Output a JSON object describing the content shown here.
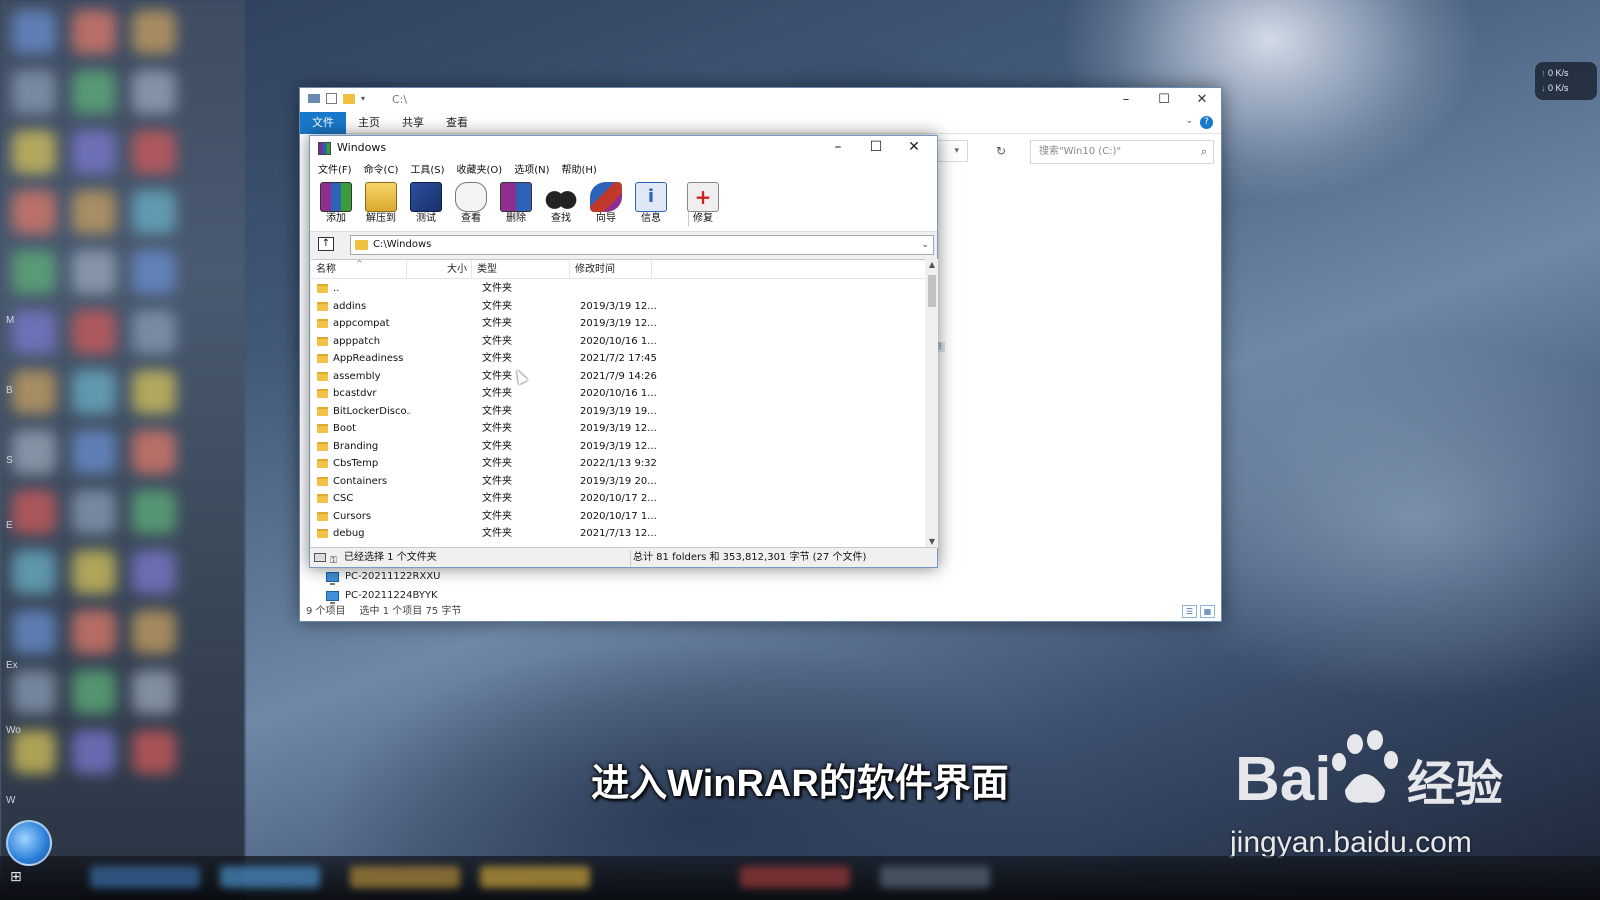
{
  "desktop": {
    "left_labels": [
      "M",
      "B",
      "S",
      "E",
      "Ex",
      "Wo",
      "W"
    ],
    "netmon": {
      "up": "0 K/s",
      "down": "0 K/s"
    }
  },
  "explorer": {
    "title_path": "C:\\",
    "tabs": [
      "文件",
      "主页",
      "共享",
      "查看"
    ],
    "search_placeholder": "搜索\"Win10 (C:)\"",
    "peek": [
      "KB",
      "KB"
    ],
    "network_items": [
      "PC-20211122RXXU",
      "PC-20211224BYYK"
    ],
    "status": {
      "items": "9 个项目",
      "selected": "选中 1 个项目  75 字节"
    }
  },
  "winrar": {
    "title": "Windows",
    "menu": [
      "文件(F)",
      "命令(C)",
      "工具(S)",
      "收藏夹(O)",
      "选项(N)",
      "帮助(H)"
    ],
    "toolbar": [
      "添加",
      "解压到",
      "测试",
      "查看",
      "删除",
      "查找",
      "向导",
      "信息",
      "修复"
    ],
    "path": "C:\\Windows",
    "columns": {
      "name": "名称",
      "size": "大小",
      "type": "类型",
      "modified": "修改时间"
    },
    "rows": [
      {
        "name": "..",
        "type": "文件夹",
        "date": ""
      },
      {
        "name": "addins",
        "type": "文件夹",
        "date": "2019/3/19 12..."
      },
      {
        "name": "appcompat",
        "type": "文件夹",
        "date": "2019/3/19 12..."
      },
      {
        "name": "apppatch",
        "type": "文件夹",
        "date": "2020/10/16 1..."
      },
      {
        "name": "AppReadiness",
        "type": "文件夹",
        "date": "2021/7/2 17:45"
      },
      {
        "name": "assembly",
        "type": "文件夹",
        "date": "2021/7/9 14:26"
      },
      {
        "name": "bcastdvr",
        "type": "文件夹",
        "date": "2020/10/16 1..."
      },
      {
        "name": "BitLockerDisco...",
        "type": "文件夹",
        "date": "2019/3/19 19..."
      },
      {
        "name": "Boot",
        "type": "文件夹",
        "date": "2019/3/19 12..."
      },
      {
        "name": "Branding",
        "type": "文件夹",
        "date": "2019/3/19 12..."
      },
      {
        "name": "CbsTemp",
        "type": "文件夹",
        "date": "2022/1/13 9:32"
      },
      {
        "name": "Containers",
        "type": "文件夹",
        "date": "2019/3/19 20..."
      },
      {
        "name": "CSC",
        "type": "文件夹",
        "date": "2020/10/17 2..."
      },
      {
        "name": "Cursors",
        "type": "文件夹",
        "date": "2020/10/17 1..."
      },
      {
        "name": "debug",
        "type": "文件夹",
        "date": "2021/7/13 12..."
      }
    ],
    "status_selected": "已经选择 1 个文件夹",
    "status_total": "总计 81 folders 和 353,812,301 字节 (27 个文件)"
  },
  "subtitle": "进入WinRAR的软件界面",
  "watermark": {
    "brand_left": "Bai",
    "brand_right": "经验",
    "url": "jingyan.baidu.com"
  }
}
